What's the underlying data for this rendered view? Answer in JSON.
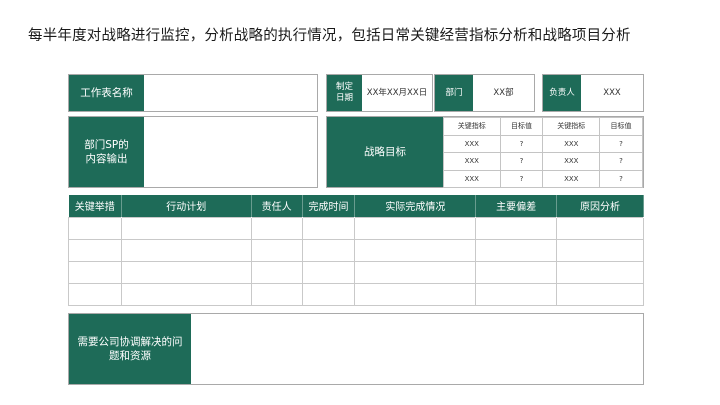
{
  "heading": "每半年度对战略进行监控，分析战略的执行情况，包括日常关键经营指标分析和战略项目分析",
  "header_row": {
    "form_name_label": "工作表名称",
    "created_date_label": "制定日期",
    "created_date_value": "XX年XX月XX日",
    "department_label": "部门",
    "department_value": "XX部",
    "owner_label": "负责人",
    "owner_value": "XXX"
  },
  "sp_output_label": "部门SP的内容输出",
  "strategy_goal_label": "战略目标",
  "kpi_table": {
    "headers": [
      "关键指标",
      "目标值",
      "关键指标",
      "目标值"
    ],
    "rows": [
      [
        "XXX",
        "?",
        "XXX",
        "?"
      ],
      [
        "XXX",
        "?",
        "XXX",
        "?"
      ],
      [
        "XXX",
        "?",
        "XXX",
        "?"
      ]
    ]
  },
  "action_table": {
    "headers": [
      "关键举措",
      "行动计划",
      "责任人",
      "完成时间",
      "实际完成情况",
      "主要偏差",
      "原因分析"
    ],
    "row_count": 4
  },
  "issues_label": "需要公司协调解决的问题和资源"
}
